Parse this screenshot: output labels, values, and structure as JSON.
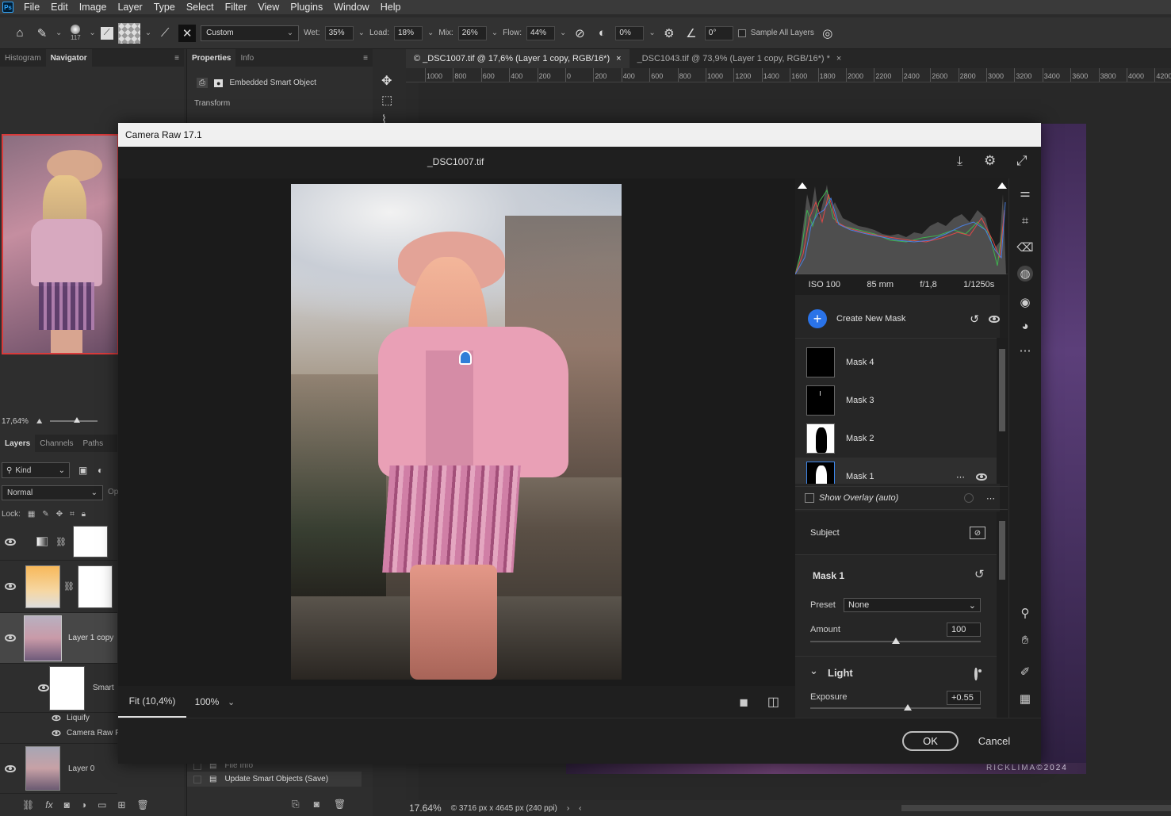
{
  "menubar": {
    "logo": "Ps",
    "items": [
      "File",
      "Edit",
      "Image",
      "Layer",
      "Type",
      "Select",
      "Filter",
      "View",
      "Plugins",
      "Window",
      "Help"
    ]
  },
  "optionsbar": {
    "brush_size": "117",
    "preset": "Custom",
    "wet_label": "Wet:",
    "wet": "35%",
    "load_label": "Load:",
    "load": "18%",
    "mix_label": "Mix:",
    "mix": "26%",
    "flow_label": "Flow:",
    "flow": "44%",
    "smoothing": "0%",
    "angle": "0°",
    "sample_all_layers": "Sample All Layers"
  },
  "left_panel": {
    "tabs": [
      "Histogram",
      "Navigator"
    ],
    "zoom": "17,64%",
    "layers_tabs": [
      "Layers",
      "Channels",
      "Paths"
    ],
    "kind": "Kind",
    "blend_mode": "Normal",
    "opacity_label": "Op",
    "lock_label": "Lock:",
    "layers": [
      {
        "name": ""
      },
      {
        "name": ""
      },
      {
        "name": "Layer 1 copy"
      },
      {
        "name": "Smart"
      },
      {
        "name": "Liquify"
      },
      {
        "name": "Camera Raw Fil"
      },
      {
        "name": "Layer 0"
      }
    ]
  },
  "mid_panel": {
    "tabs": [
      "Properties",
      "Info"
    ],
    "type": "Embedded Smart Object",
    "section": "Transform",
    "history": [
      "File Info",
      "Update Smart Objects (Save)"
    ]
  },
  "doc_tabs": [
    {
      "title": "© _DSC1007.tif @ 17,6% (Layer 1 copy, RGB/16*)",
      "active": true
    },
    {
      "title": "_DSC1043.tif @ 73,9% (Layer 1 copy, RGB/16*) *",
      "active": false
    }
  ],
  "ruler_ticks": [
    "1000",
    "800",
    "600",
    "400",
    "200",
    "0",
    "200",
    "400",
    "600",
    "800",
    "1000",
    "1200",
    "1400",
    "1600",
    "1800",
    "2000",
    "2200",
    "2400",
    "2600",
    "2800",
    "3000",
    "3200",
    "3400",
    "3600",
    "3800",
    "4000",
    "4200"
  ],
  "statusbar": {
    "zoom": "17.64%",
    "info": "© 3716 px x 4645 px (240 ppi)"
  },
  "watermark": "RICKLIMA©2024",
  "camera_raw": {
    "title": "Camera Raw 17.1",
    "filename": "_DSC1007.tif",
    "fit": "Fit (10,4%)",
    "zoom": "100%",
    "histogram_meta": [
      "ISO 100",
      "85 mm",
      "f/1,8",
      "1/1250s"
    ],
    "create_mask": "Create New Mask",
    "masks": [
      "Mask 4",
      "Mask 3",
      "Mask 2",
      "Mask 1"
    ],
    "show_overlay": "Show Overlay (auto)",
    "subject": "Subject",
    "mask_section": "Mask 1",
    "preset_label": "Preset",
    "preset_value": "None",
    "amount_label": "Amount",
    "amount_value": 100,
    "light_section": "Light",
    "exposure_label": "Exposure",
    "exposure_value": "+0.55",
    "ok": "OK",
    "cancel": "Cancel"
  }
}
